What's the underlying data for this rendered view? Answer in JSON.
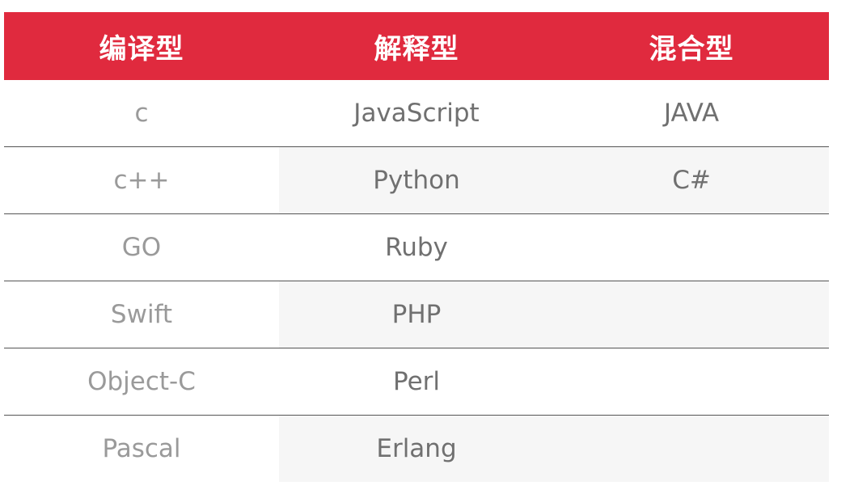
{
  "colors": {
    "accent": "#E02A3E",
    "shade": "#F6F6F6",
    "divider": "#555555"
  },
  "table": {
    "headers": [
      "编译型",
      "解释型",
      "混合型"
    ],
    "rows": [
      [
        "c",
        "JavaScript",
        "JAVA"
      ],
      [
        "c++",
        "Python",
        "C#"
      ],
      [
        "GO",
        "Ruby",
        ""
      ],
      [
        "Swift",
        "PHP",
        ""
      ],
      [
        "Object-C",
        "Perl",
        ""
      ],
      [
        "Pascal",
        "Erlang",
        ""
      ]
    ]
  }
}
